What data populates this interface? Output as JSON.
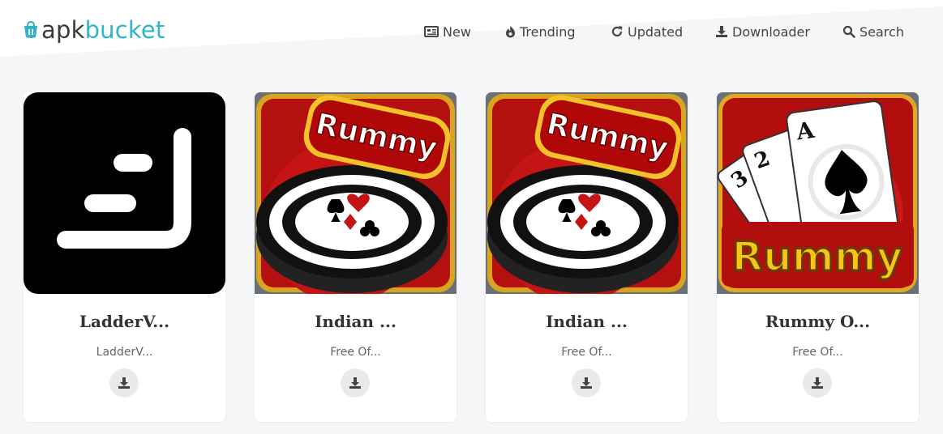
{
  "brand": {
    "part1": "apk",
    "part2": "bucket",
    "color": "#30b5c8"
  },
  "nav": [
    {
      "label": "New",
      "icon": "newspaper-icon"
    },
    {
      "label": "Trending",
      "icon": "fire-icon"
    },
    {
      "label": "Updated",
      "icon": "refresh-icon"
    },
    {
      "label": "Downloader",
      "icon": "download-icon"
    },
    {
      "label": "Search",
      "icon": "search-icon"
    }
  ],
  "apps": [
    {
      "title": "LadderV...",
      "subtitle": "LadderV...",
      "icon": "ladderv-app-icon"
    },
    {
      "title": "Indian ...",
      "subtitle": "Free Of...",
      "icon": "indian-rummy-app-icon"
    },
    {
      "title": "Indian ...",
      "subtitle": "Free Of...",
      "icon": "indian-rummy-app-icon"
    },
    {
      "title": "Rummy O...",
      "subtitle": "Free Of...",
      "icon": "rummy-offline-app-icon"
    }
  ]
}
